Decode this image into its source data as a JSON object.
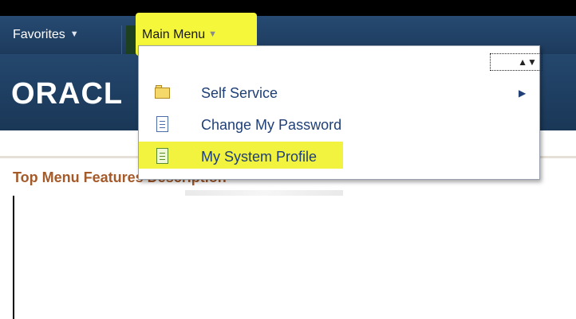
{
  "nav": {
    "favorites_label": "Favorites",
    "main_menu_label": "Main Menu"
  },
  "banner": {
    "logo_text": "ORACL"
  },
  "menu": {
    "scroll_glyph": "▲▼",
    "items": [
      {
        "label": "Self Service",
        "icon": "folder-icon",
        "has_submenu": true
      },
      {
        "label": "Change My Password",
        "icon": "document-icon",
        "has_submenu": false
      },
      {
        "label": "My System Profile",
        "icon": "document-icon",
        "has_submenu": false,
        "highlighted": true
      }
    ]
  },
  "section": {
    "title": "Top Menu Features Description"
  },
  "colors": {
    "nav_bg": "#1d3a5c",
    "highlight": "#f5f73a",
    "link": "#1f3f76",
    "section_title": "#a55a2a"
  }
}
